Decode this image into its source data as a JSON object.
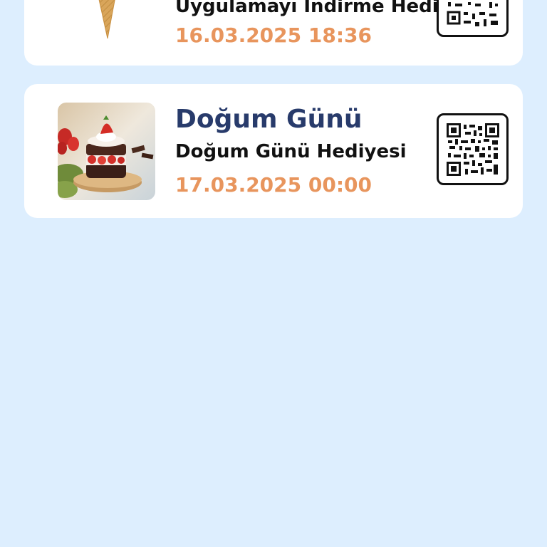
{
  "cards": [
    {
      "subtitle": "Uygulamayı İndirme Hediyesi",
      "date": "16.03.2025 18:36",
      "image_icon": "ice-cream-cone-icon",
      "qr_icon": "qr-code-icon"
    },
    {
      "title": "Doğum Günü",
      "subtitle": "Doğum Günü Hediyesi",
      "date": "17.03.2025 00:00",
      "image_icon": "strawberry-cake-image",
      "qr_icon": "qr-code-icon"
    }
  ],
  "colors": {
    "background": "#ddeefe",
    "card": "#ffffff",
    "title": "#283b6b",
    "date": "#e8955d"
  }
}
